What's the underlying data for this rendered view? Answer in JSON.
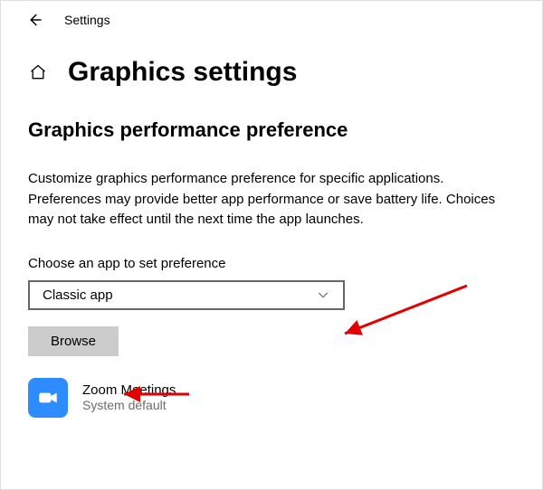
{
  "topbar": {
    "title": "Settings"
  },
  "header": {
    "title": "Graphics settings"
  },
  "section": {
    "heading": "Graphics performance preference",
    "description": "Customize graphics performance preference for specific applications. Preferences may provide better app performance or save battery life. Choices may not take effect until the next time the app launches.",
    "choose_label": "Choose an app to set preference",
    "select_value": "Classic app",
    "browse_label": "Browse"
  },
  "apps": [
    {
      "name": "Zoom Meetings",
      "preference": "System default",
      "icon_name": "zoom"
    }
  ]
}
